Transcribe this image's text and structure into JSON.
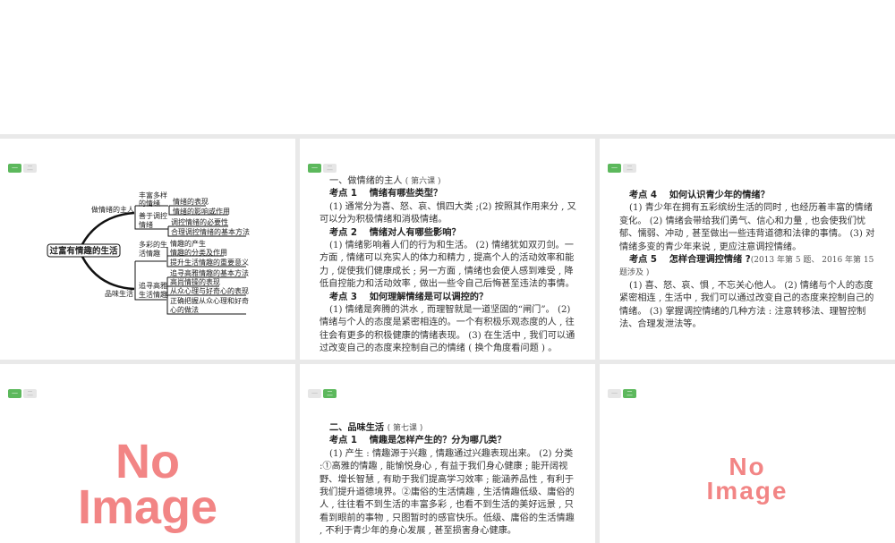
{
  "tags": {
    "first": "一",
    "second": "二"
  },
  "mindmap": {
    "center": "过富有情趣的生活",
    "branch1": "做情绪的主人",
    "branch2": "品味生活",
    "b1_n1_a": "丰富多样",
    "b1_n1_b": "的情绪",
    "b1_n2_a": "善于调控",
    "b1_n2_b": "情绪",
    "b1_items": [
      "情绪的表现",
      "情绪的影响或作用",
      "调控情绪的必要性",
      "合理调控情绪的基本方法"
    ],
    "b2_n1_a": "多彩的生",
    "b2_n1_b": "活情趣",
    "b2_n2_a": "追寻高雅",
    "b2_n2_b": "生活情趣",
    "b2_items": [
      "情趣的产生",
      "情趣的分类及作用",
      "提升生活情趣的重要意义",
      "追寻高雅情趣的基本方法",
      "高尚情操的表现",
      "从众心理与好奇心的表现",
      "正确把握从众心理和好奇",
      "心的做法"
    ]
  },
  "slide2": {
    "title": "一、做情绪的主人",
    "title_note": "( 第六课 )",
    "k1": "考点 1　 情绪有哪些类型？",
    "k1_body": "(1) 通常分为喜、怒、哀、惧四大类 ;(2) 按照其作用来分 , 又可以分为积极情绪和消极情绪。",
    "k2": "考点 2　 情绪对人有哪些影响？",
    "k2_body": "(1) 情绪影响着人们的行为和生活。 (2) 情绪犹如双刃剑。一方面 , 情绪可以充实人的体力和精力 , 提高个人的活动效率和能力 , 促使我们健康成长 ; 另一方面 , 情绪也会使人感到难受 , 降低自控能力和活动效率 , 做出一些令自己后悔甚至违法的事情。",
    "k3": "考点 3　 如何理解情绪是可以调控的？",
    "k3_body": "(1) 情绪是奔腾的洪水 , 而理智就是一道坚固的“闸门”。 (2) 情绪与个人的态度是紧密相连的。一个有积极乐观态度的人 , 往往会有更多的积极健康的情绪表现。 (3) 在生活中 , 我们可以通过改变自己的态度来控制自己的情绪 ( 换个角度看问题 ) 。"
  },
  "slide3": {
    "k4": "考点 4　 如何认识青少年的情绪？",
    "k4_body": "(1) 青少年在拥有五彩缤纷生活的同时 , 也经历着丰富的情绪变化。 (2) 情绪会带给我们勇气、信心和力量 , 也会使我们忧郁、懦弱、冲动 , 甚至做出一些违背道德和法律的事情。 (3) 对情绪多变的青少年来说 , 更应注意调控情绪。",
    "k5": "考点 5　 怎样合理调控情绪 ?",
    "k5_note": "(2013 年第 5 题、 2016 年第 15 题涉及 )",
    "k5_body": "(1) 喜、怒、哀、惧 , 不忘关心他人。 (2) 情绪与个人的态度紧密相连 , 生活中 , 我们可以通过改变自己的态度来控制自己的情绪。 (3) 掌握调控情绪的几种方法 : 注意转移法、理智控制法、合理发泄法等。"
  },
  "slide5": {
    "title": "二、品味生活",
    "title_note": "( 第七课 )",
    "k1": "考点 1　 情趣是怎样产生的？分为哪几类？",
    "k1_body": "(1) 产生 : 情趣源于兴趣 , 情趣通过兴趣表现出来。 (2) 分类 :①高雅的情趣 , 能愉悦身心 , 有益于我们身心健康 ; 能开阔视野、增长智慧 , 有助于我们提高学习效率 ; 能涵养品性 , 有利于我们提升道德境界。②庸俗的生活情趣 , 生活情趣低级、庸俗的人 , 往往看不到生活的丰富多彩 , 也看不到生活的美好远景 , 只看到眼前的事物 , 只图暂时的感官快乐。低级、庸俗的生活情趣 , 不利于青少年的身心发展 , 甚至损害身心健康。"
  },
  "placeholder": {
    "line1": "No",
    "line2": "Image"
  }
}
